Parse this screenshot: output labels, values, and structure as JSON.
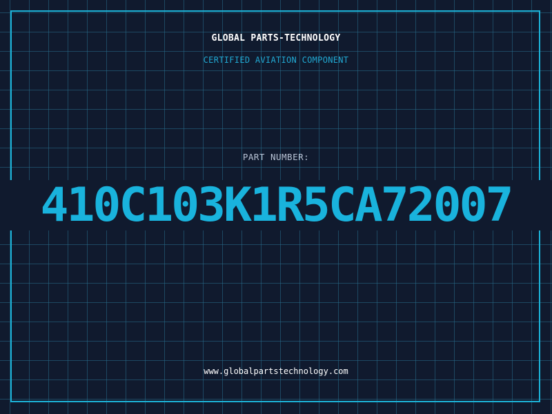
{
  "header": {
    "company": "GLOBAL PARTS-TECHNOLOGY",
    "subtitle": "CERTIFIED AVIATION COMPONENT"
  },
  "part": {
    "label": "PART NUMBER:",
    "number": "410C103K1R5CA72007"
  },
  "footer": {
    "url": "www.globalpartstechnology.com"
  },
  "colors": {
    "background": "#101a2e",
    "grid": "#286e8c",
    "accent": "#1cb3d8",
    "text": "#ffffff",
    "label": "#b9c4d6"
  }
}
